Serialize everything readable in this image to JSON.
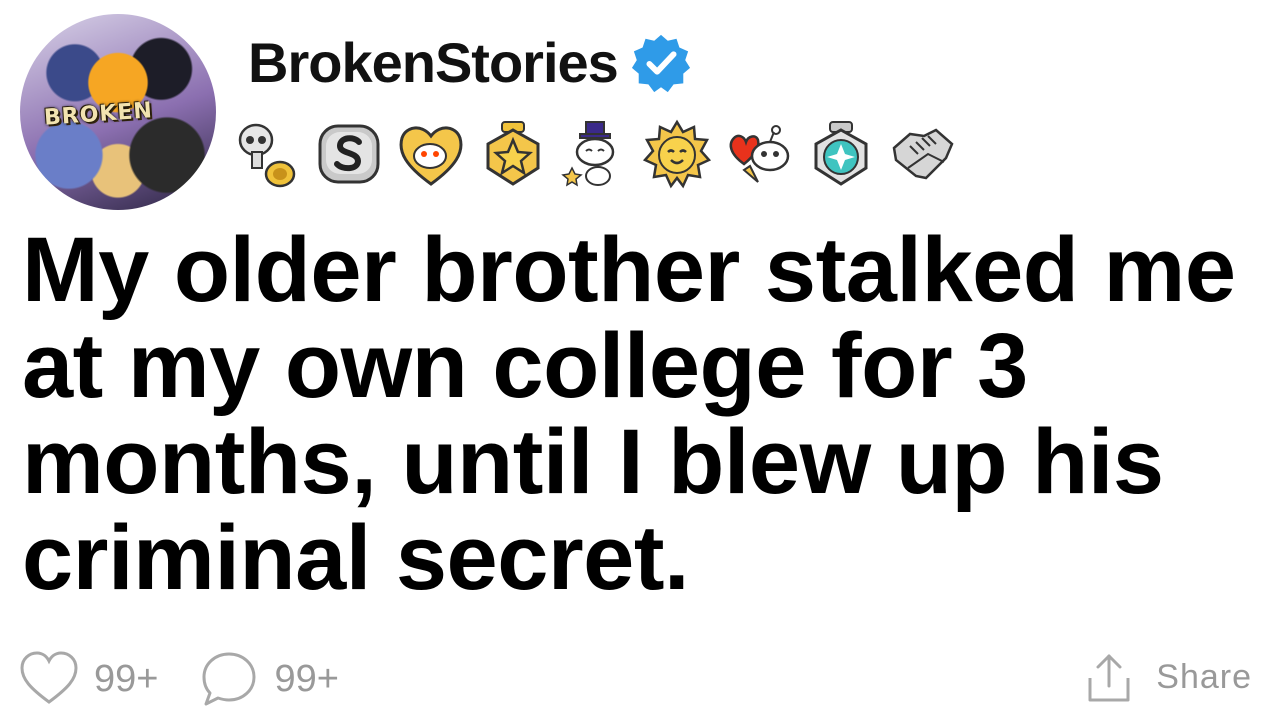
{
  "post": {
    "author": {
      "name": "BrokenStories",
      "avatar_text": "BROKEN",
      "verified": true,
      "verified_color": "#2f9be8"
    },
    "badges": [
      {
        "name": "skull-trophy-badge-icon"
      },
      {
        "name": "silver-s-badge-icon"
      },
      {
        "name": "snoo-heart-badge-icon"
      },
      {
        "name": "gold-star-badge-icon"
      },
      {
        "name": "snoo-magician-badge-icon"
      },
      {
        "name": "sun-face-badge-icon"
      },
      {
        "name": "snoo-love-badge-icon"
      },
      {
        "name": "diamond-gem-badge-icon"
      },
      {
        "name": "handshake-badge-icon"
      }
    ],
    "title": "My older brother stalked me at my own college for 3 months, until I blew up his criminal secret.",
    "actions": {
      "likes": "99+",
      "comments": "99+",
      "share_label": "Share"
    }
  }
}
